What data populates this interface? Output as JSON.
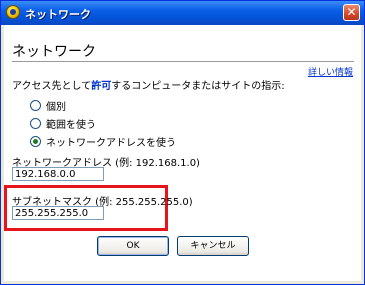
{
  "window": {
    "title": "ネットワーク",
    "close_glyph": "✕"
  },
  "header": {
    "title": "ネットワーク",
    "help_link": "詳しい情報"
  },
  "instruction": {
    "prefix": "アクセス先として",
    "emphasis": "許可",
    "suffix": "するコンピュータまたはサイトの指示:"
  },
  "options": [
    {
      "label": "個別",
      "checked": false
    },
    {
      "label": "範囲を使う",
      "checked": false
    },
    {
      "label": "ネットワークアドレスを使う",
      "checked": true
    }
  ],
  "network_address": {
    "label": "ネットワークアドレス (例: 192.168.1.0)",
    "value": "192.168.0.0"
  },
  "subnet_mask": {
    "label": "サブネットマスク (例: 255.255.255.0)",
    "value": "255.255.255.0"
  },
  "buttons": {
    "ok": "OK",
    "cancel": "キャンセル"
  },
  "colors": {
    "highlight": "#e8141c",
    "title_bar": "#0a5ee6",
    "link": "#0033cc"
  }
}
